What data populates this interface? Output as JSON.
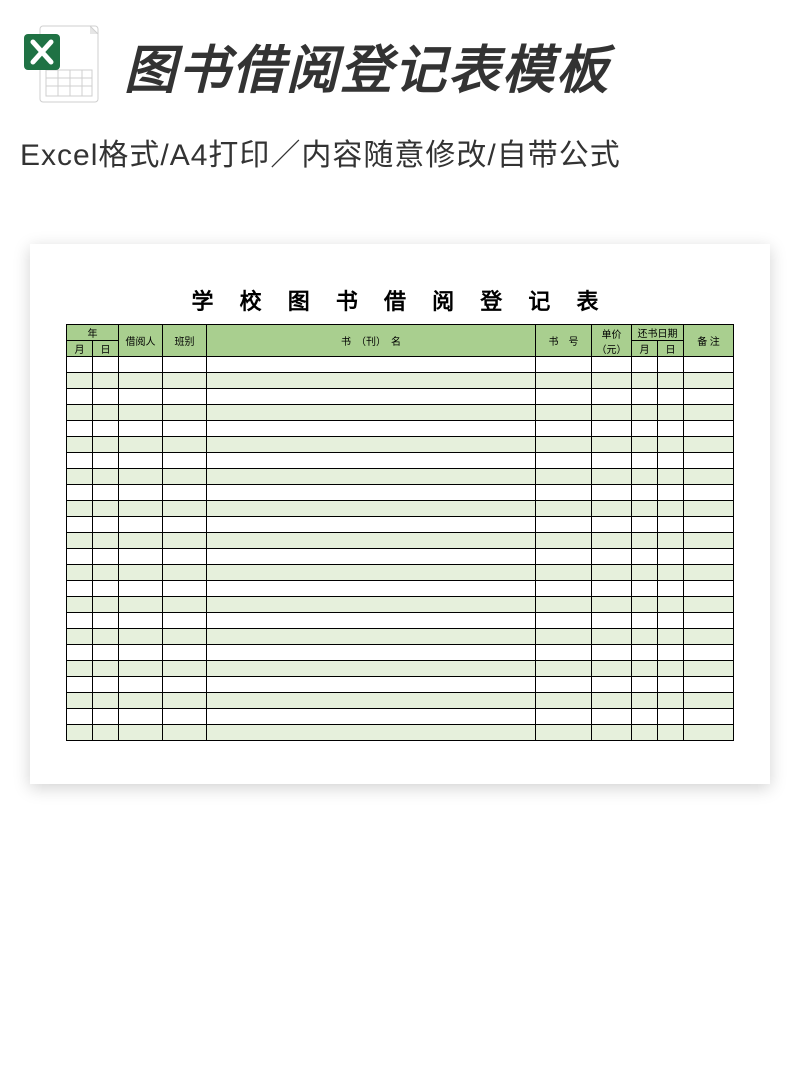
{
  "header": {
    "title": "图书借阅登记表模板",
    "subtitle": "Excel格式/A4打印／内容随意修改/自带公式",
    "icon_name": "excel-file-icon"
  },
  "sheet": {
    "title": "学 校 图 书 借 阅 登 记 表",
    "columns": {
      "year": "年",
      "month": "月",
      "day": "日",
      "borrower": "借阅人",
      "class": "班别",
      "book_name": "书　（刊）　名",
      "book_no": "书　号",
      "price": "单价（元）",
      "return_date": "还书日期",
      "return_month": "月",
      "return_day": "日",
      "note": "备 注"
    },
    "row_count": 24
  }
}
